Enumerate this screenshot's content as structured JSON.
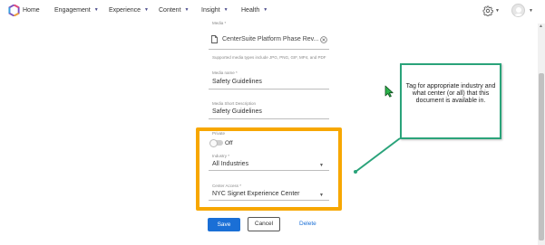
{
  "nav": {
    "items": [
      {
        "label": "Home",
        "has_caret": false
      },
      {
        "label": "Engagement",
        "has_caret": true
      },
      {
        "label": "Experience",
        "has_caret": true
      },
      {
        "label": "Content",
        "has_caret": true
      },
      {
        "label": "Insight",
        "has_caret": true
      },
      {
        "label": "Health",
        "has_caret": true
      }
    ],
    "caret_glyph": "▼",
    "icons": {
      "logo": "app-logo-icon",
      "settings": "gear-icon",
      "profile": "avatar-icon"
    }
  },
  "form": {
    "media": {
      "label": "Media *",
      "file_name": "CenterSuite Platform Phase Rev...",
      "hint": "Supported media types include JPG, PNG, GIF, MP4, and PDF"
    },
    "media_name": {
      "label": "Media name *",
      "value": "Safety Guidelines"
    },
    "media_short_description": {
      "label": "Media Short Description",
      "value": "Safety Guidelines"
    },
    "private": {
      "label": "Private",
      "state": "Off"
    },
    "industry": {
      "label": "Industry *",
      "value": "All Industries"
    },
    "center_access": {
      "label": "Center Access *",
      "value": "NYC Signet Experience Center"
    }
  },
  "actions": {
    "save": "Save",
    "cancel": "Cancel",
    "delete": "Delete"
  },
  "callout": {
    "text": "Tag for appropriate industry and what center (or all) that this document is available in."
  },
  "colors": {
    "highlight": "#f7a700",
    "callout_border": "#2aa37a",
    "cursor": "#2bb34a",
    "primary": "#1a6fd6"
  }
}
